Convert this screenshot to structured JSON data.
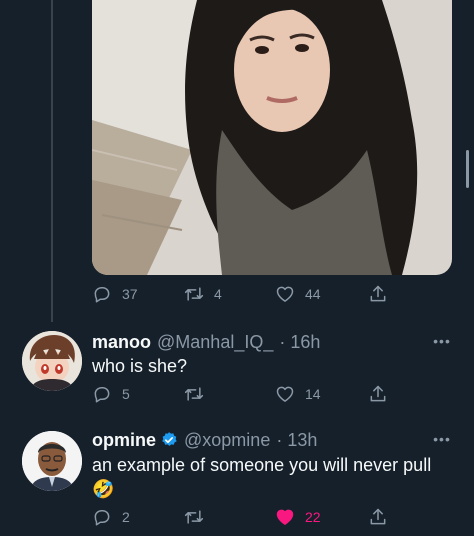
{
  "tweet": {
    "stats": {
      "replies": "37",
      "retweets": "4",
      "likes": "44"
    }
  },
  "replies": [
    {
      "display_name": "manoo",
      "handle": "@Manhal_IQ_",
      "time": "· 16h",
      "text": "who is she?",
      "stats": {
        "replies": "5",
        "retweets": "",
        "likes": "14"
      },
      "liked": false
    },
    {
      "display_name": "opmine",
      "handle": "@xopmine",
      "time": "· 13h",
      "verified": true,
      "text": "an example of someone you will never pull",
      "emoji": "🤣",
      "stats": {
        "replies": "2",
        "retweets": "",
        "likes": "22"
      },
      "liked": true
    }
  ],
  "icons": {
    "reply": "reply-icon",
    "retweet": "retweet-icon",
    "like": "heart-icon",
    "share": "share-icon",
    "more": "more-icon",
    "verified": "verified-badge-icon"
  },
  "colors": {
    "background": "#15202b",
    "text": "#f7f9f9",
    "secondary": "#8b98a5",
    "like_active": "#f91880",
    "verified": "#1d9bf0"
  },
  "more_glyph": "•••"
}
